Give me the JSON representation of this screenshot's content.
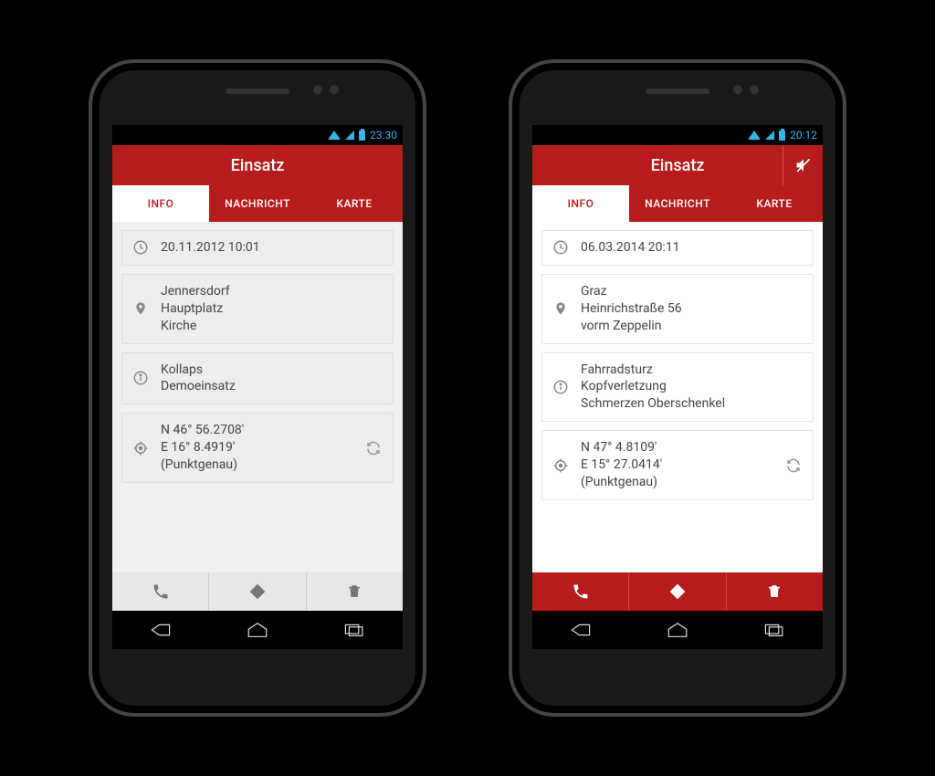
{
  "left": {
    "status_time": "23:30",
    "title": "Einsatz",
    "has_mute": false,
    "tabs": {
      "info": "INFO",
      "nachricht": "NACHRICHT",
      "karte": "KARTE",
      "active": "info"
    },
    "content_style": "grey",
    "cards": {
      "time": {
        "line1": "20.11.2012 10:01"
      },
      "location": {
        "line1": "Jennersdorf",
        "line2": "Hauptplatz",
        "line3": "Kirche"
      },
      "info": {
        "line1": "Kollaps",
        "line2": "Demoeinsatz"
      },
      "coords": {
        "line1": "N 46° 56.2708'",
        "line2": "E 16° 8.4919'",
        "line3": "(Punktgenau)"
      }
    },
    "action_style": "grey"
  },
  "right": {
    "status_time": "20:12",
    "title": "Einsatz",
    "has_mute": true,
    "tabs": {
      "info": "INFO",
      "nachricht": "NACHRICHT",
      "karte": "KARTE",
      "active": "info"
    },
    "content_style": "whitecards",
    "cards": {
      "time": {
        "line1": "06.03.2014 20:11"
      },
      "location": {
        "line1": "Graz",
        "line2": "Heinrichstraße 56",
        "line3": "vorm Zeppelin"
      },
      "info": {
        "line1": "Fahrradsturz",
        "line2": "Kopfverletzung",
        "line3": "Schmerzen Oberschenkel"
      },
      "coords": {
        "line1": "N 47° 4.8109'",
        "line2": "E 15° 27.0414'",
        "line3": "(Punktgenau)"
      }
    },
    "action_style": "red"
  }
}
